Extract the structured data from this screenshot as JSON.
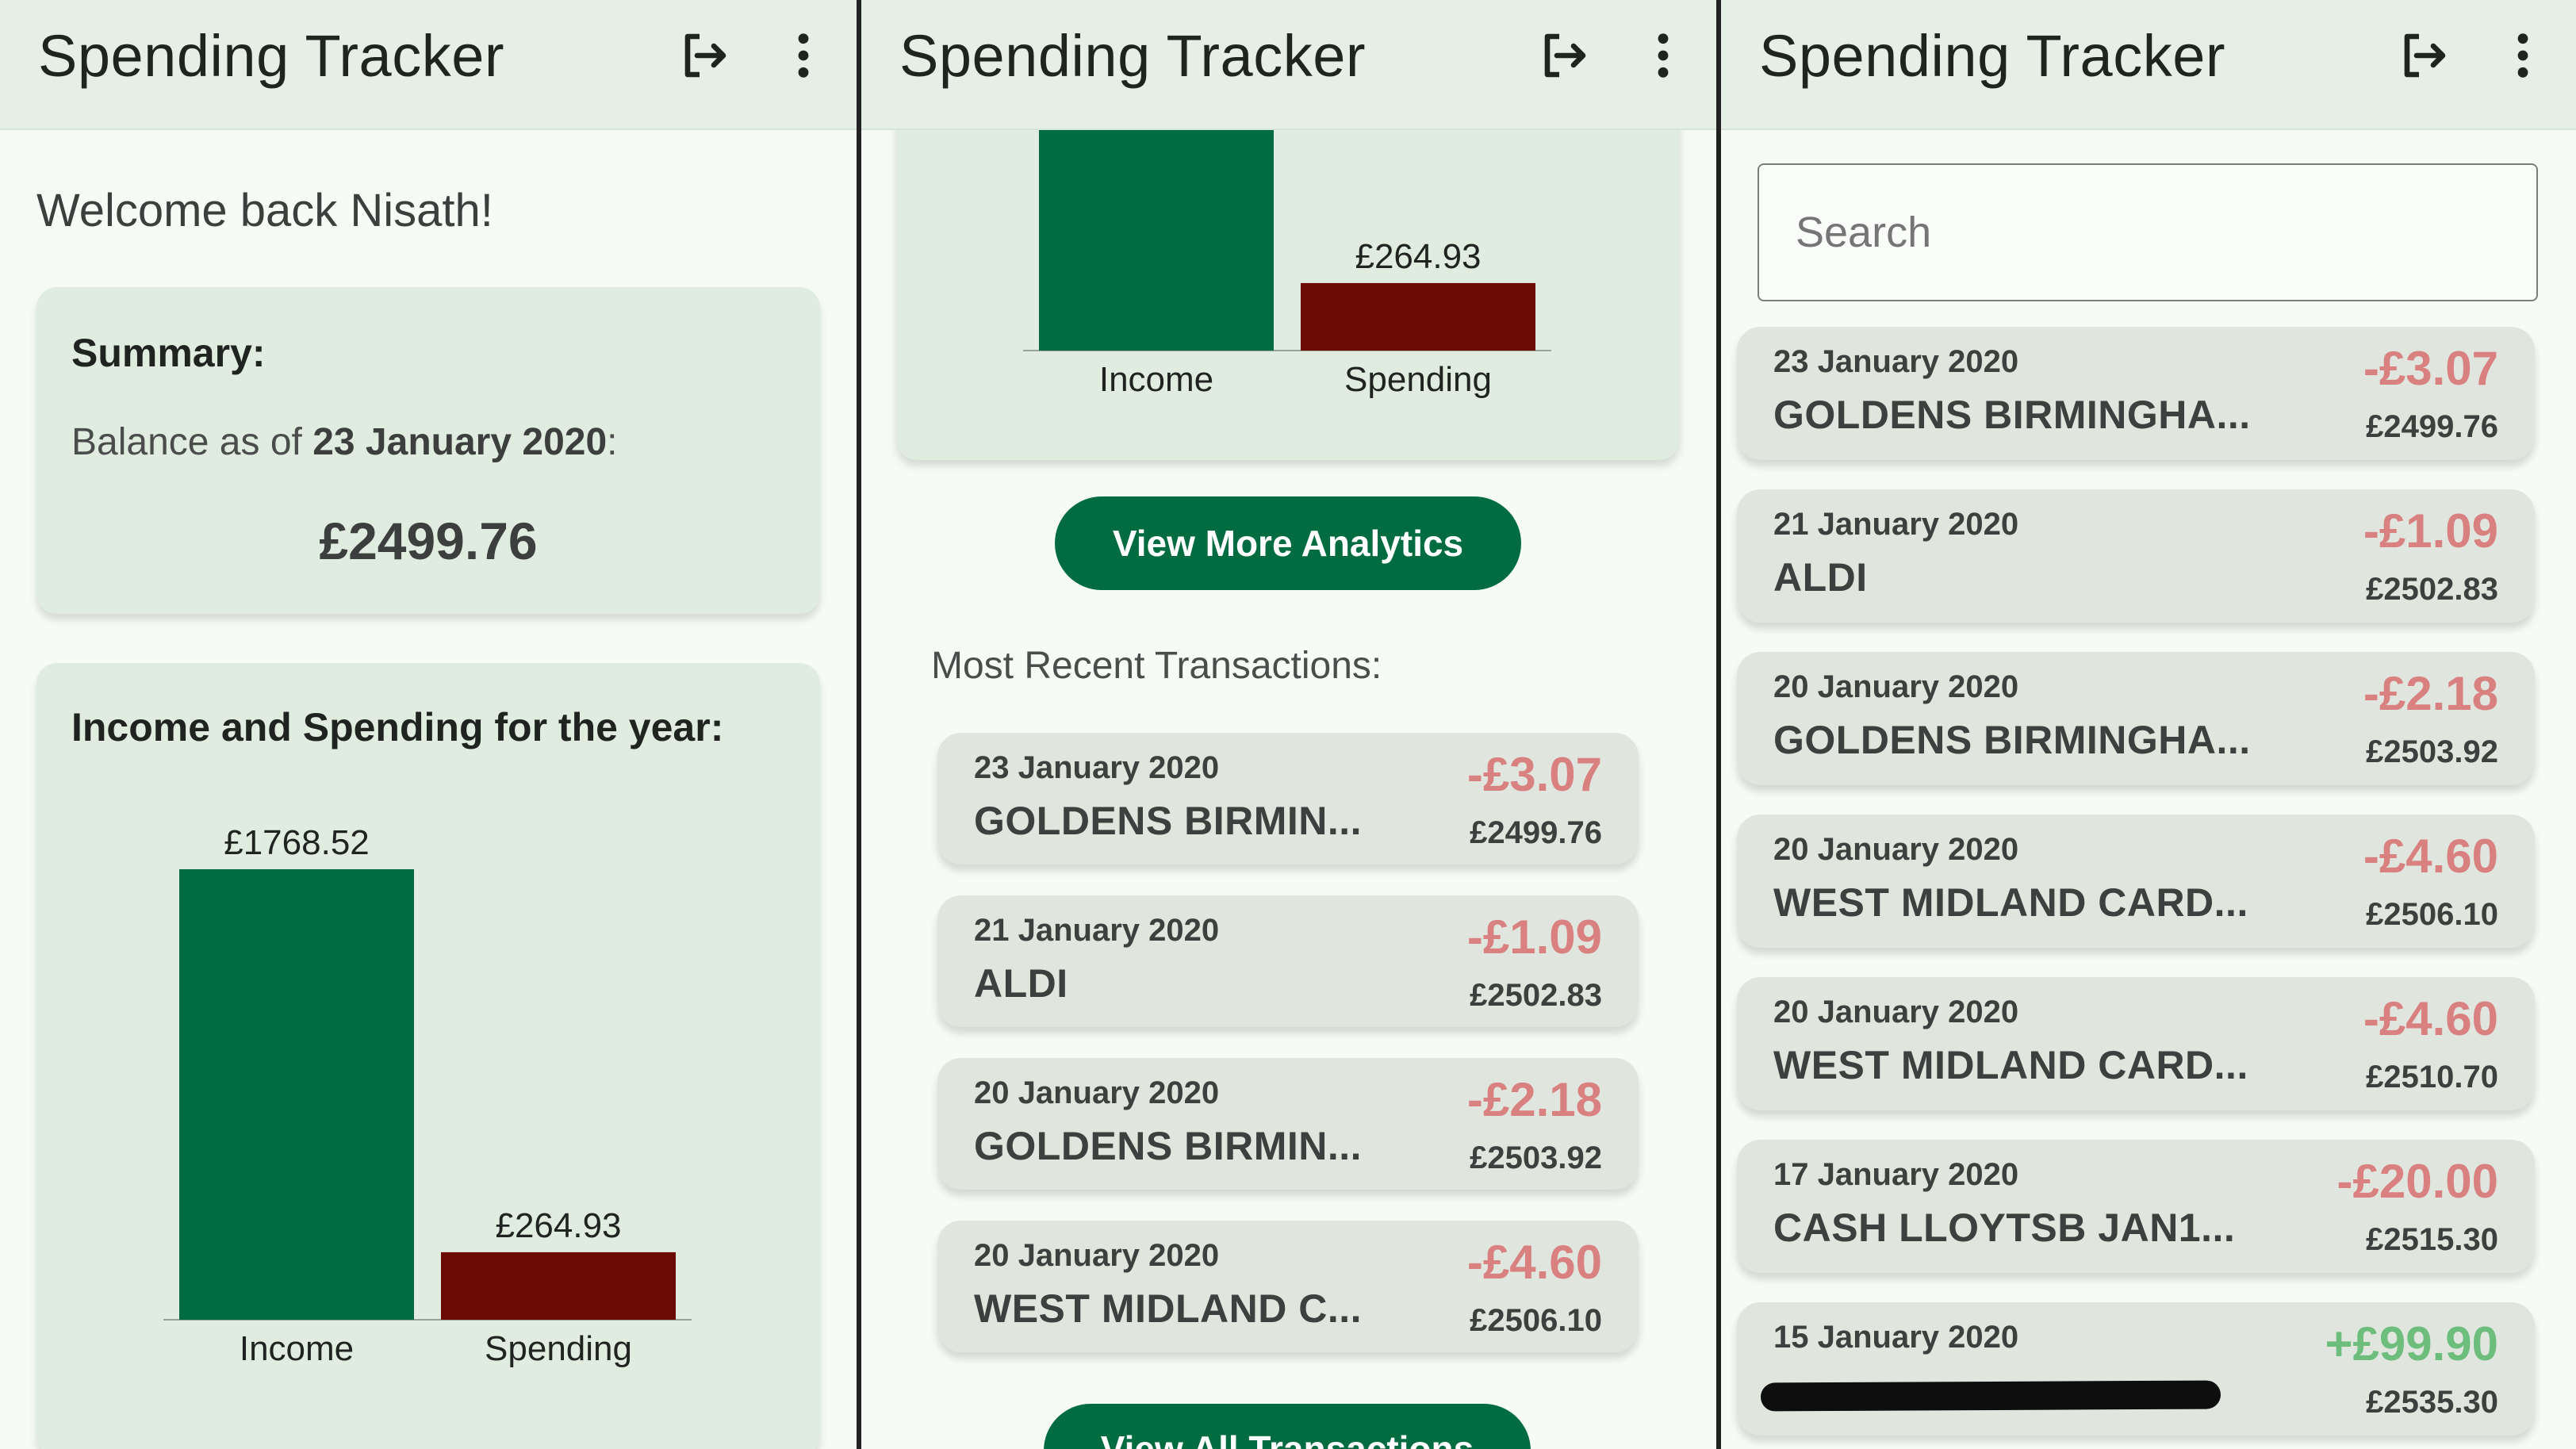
{
  "app_title": "Spending Tracker",
  "colors": {
    "income_bar": "#016c40",
    "spending_bar": "#6b0a03",
    "negative_amount": "#d98080",
    "positive_amount": "#6dbd7d",
    "button": "#016c40"
  },
  "icons": {
    "logout": "logout-icon",
    "menu": "more-vert-icon"
  },
  "panel1": {
    "welcome": "Welcome back Nisath!",
    "summary": {
      "heading": "Summary:",
      "balance_prefix": "Balance as of ",
      "balance_date": "23 January 2020",
      "balance_suffix": ":",
      "balance": "£2499.76"
    },
    "chart_heading": "Income and Spending for the year:"
  },
  "chart_data": {
    "type": "bar",
    "categories": [
      "Income",
      "Spending"
    ],
    "values": [
      1768.52,
      264.93
    ],
    "value_labels": [
      "£1768.52",
      "£264.93"
    ],
    "title": "Income and Spending for the year:",
    "ylim": [
      0,
      1768.52
    ],
    "grid": false
  },
  "panel2": {
    "analytics_button": "View More Analytics",
    "recent_heading": "Most Recent Transactions:",
    "all_button": "View All Transactions",
    "transactions": [
      {
        "date": "23 January 2020",
        "desc": "GOLDENS BIRMIN...",
        "amount": "-£3.07",
        "balance": "£2499.76"
      },
      {
        "date": "21 January 2020",
        "desc": "ALDI",
        "amount": "-£1.09",
        "balance": "£2502.83"
      },
      {
        "date": "20 January 2020",
        "desc": "GOLDENS BIRMIN...",
        "amount": "-£2.18",
        "balance": "£2503.92"
      },
      {
        "date": "20 January 2020",
        "desc": "WEST MIDLAND C...",
        "amount": "-£4.60",
        "balance": "£2506.10"
      }
    ]
  },
  "panel3": {
    "search_placeholder": "Search",
    "transactions": [
      {
        "date": "23 January 2020",
        "desc": "GOLDENS BIRMINGHA...",
        "amount": "-£3.07",
        "balance": "£2499.76",
        "sign": "neg"
      },
      {
        "date": "21 January 2020",
        "desc": "ALDI",
        "amount": "-£1.09",
        "balance": "£2502.83",
        "sign": "neg"
      },
      {
        "date": "20 January 2020",
        "desc": "GOLDENS BIRMINGHA...",
        "amount": "-£2.18",
        "balance": "£2503.92",
        "sign": "neg"
      },
      {
        "date": "20 January 2020",
        "desc": "WEST MIDLAND CARD...",
        "amount": "-£4.60",
        "balance": "£2506.10",
        "sign": "neg"
      },
      {
        "date": "20 January 2020",
        "desc": "WEST MIDLAND CARD...",
        "amount": "-£4.60",
        "balance": "£2510.70",
        "sign": "neg"
      },
      {
        "date": "17 January 2020",
        "desc": "CASH LLOYTSB JAN1...",
        "amount": "-£20.00",
        "balance": "£2515.30",
        "sign": "neg"
      },
      {
        "date": "15 January 2020",
        "desc": "",
        "amount": "+£99.90",
        "balance": "£2535.30",
        "sign": "pos"
      }
    ]
  }
}
